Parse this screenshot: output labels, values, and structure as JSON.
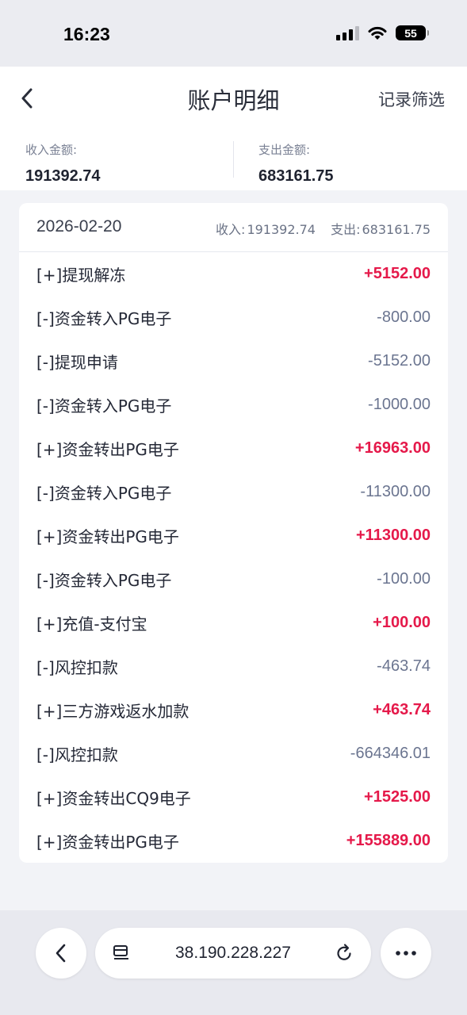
{
  "status_bar": {
    "time": "16:23",
    "battery": "55"
  },
  "nav": {
    "title": "账户明细",
    "filter_label": "记录筛选"
  },
  "summary": {
    "income_label": "收入金额:",
    "income_value": "191392.74",
    "expense_label": "支出金额:",
    "expense_value": "683161.75"
  },
  "group": {
    "date": "2026-02-20",
    "income_label": "收入:",
    "income_value": "191392.74",
    "expense_label": "支出:",
    "expense_value": "683161.75"
  },
  "transactions": [
    {
      "label": "[+]提现解冻",
      "amount": "+5152.00"
    },
    {
      "label": "[-]资金转入PG电子",
      "amount": "-800.00"
    },
    {
      "label": "[-]提现申请",
      "amount": "-5152.00"
    },
    {
      "label": "[-]资金转入PG电子",
      "amount": "-1000.00"
    },
    {
      "label": "[+]资金转出PG电子",
      "amount": "+16963.00"
    },
    {
      "label": "[-]资金转入PG电子",
      "amount": "-11300.00"
    },
    {
      "label": "[+]资金转出PG电子",
      "amount": "+11300.00"
    },
    {
      "label": "[-]资金转入PG电子",
      "amount": "-100.00"
    },
    {
      "label": "[+]充值-支付宝",
      "amount": "+100.00"
    },
    {
      "label": "[-]风控扣款",
      "amount": "-463.74"
    },
    {
      "label": "[+]三方游戏返水加款",
      "amount": "+463.74"
    },
    {
      "label": "[-]风控扣款",
      "amount": "-664346.01"
    },
    {
      "label": "[+]资金转出CQ9电子",
      "amount": "+1525.00"
    },
    {
      "label": "[+]资金转出PG电子",
      "amount": "+155889.00"
    }
  ],
  "browser": {
    "url": "38.190.228.227"
  },
  "colors": {
    "positive": "#e5194a",
    "negative": "#6b7590"
  }
}
